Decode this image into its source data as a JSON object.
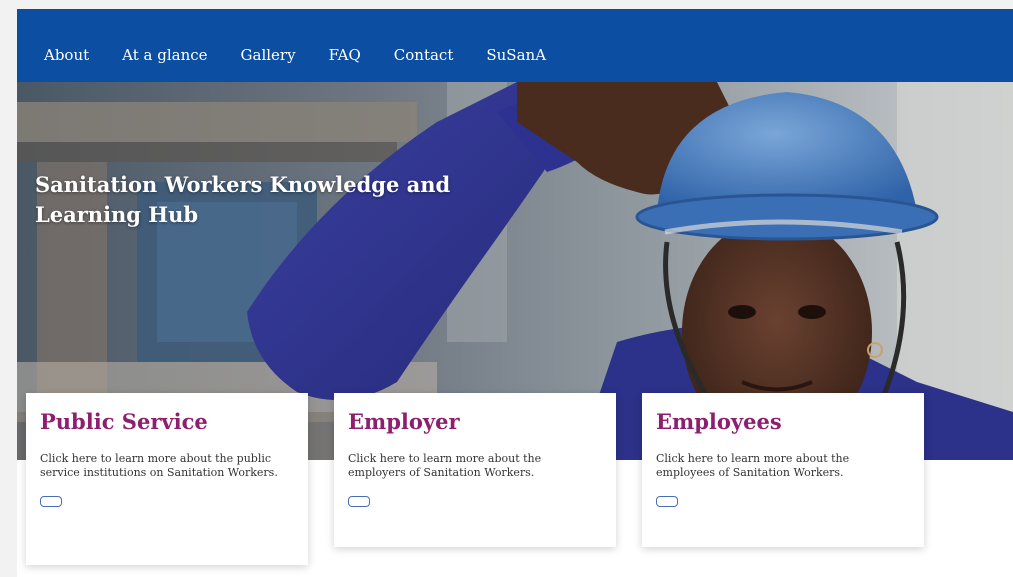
{
  "nav": {
    "items": [
      {
        "label": "About"
      },
      {
        "label": "At a glance"
      },
      {
        "label": "Gallery"
      },
      {
        "label": "FAQ"
      },
      {
        "label": "Contact"
      },
      {
        "label": "SuSanA"
      }
    ]
  },
  "hero": {
    "title": "Sanitation Workers Knowledge and Learning Hub",
    "image": "sanitation-worker-blue-helmet-photo"
  },
  "cards": [
    {
      "title": "Public Service",
      "text": "Click here to learn more about the public service institutions on Sanitation Workers."
    },
    {
      "title": "Employer",
      "text": "Click here to learn more about the employers of Sanitation Workers."
    },
    {
      "title": "Employees",
      "text": "Click here to learn more about the employees of Sanitation Workers."
    }
  ],
  "colors": {
    "nav_background": "#0b4ea2",
    "card_title": "#8e1f6f",
    "page_background": "#ffffff"
  }
}
